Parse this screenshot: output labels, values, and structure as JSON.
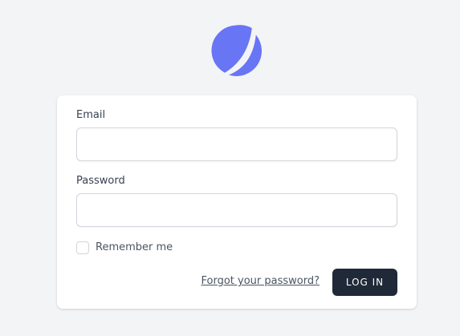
{
  "logo": {
    "icon": "brand-logo-icon",
    "color": "#6875f5"
  },
  "form": {
    "email_label": "Email",
    "email_value": "",
    "password_label": "Password",
    "password_value": "",
    "remember_label": "Remember me",
    "remember_checked": false,
    "forgot_link": "Forgot your password?",
    "login_button": "LOG IN"
  },
  "colors": {
    "page_background": "#f3f4f6",
    "card_background": "#ffffff",
    "button_background": "#1f2937",
    "button_text": "#ffffff",
    "label_text": "#374151"
  }
}
